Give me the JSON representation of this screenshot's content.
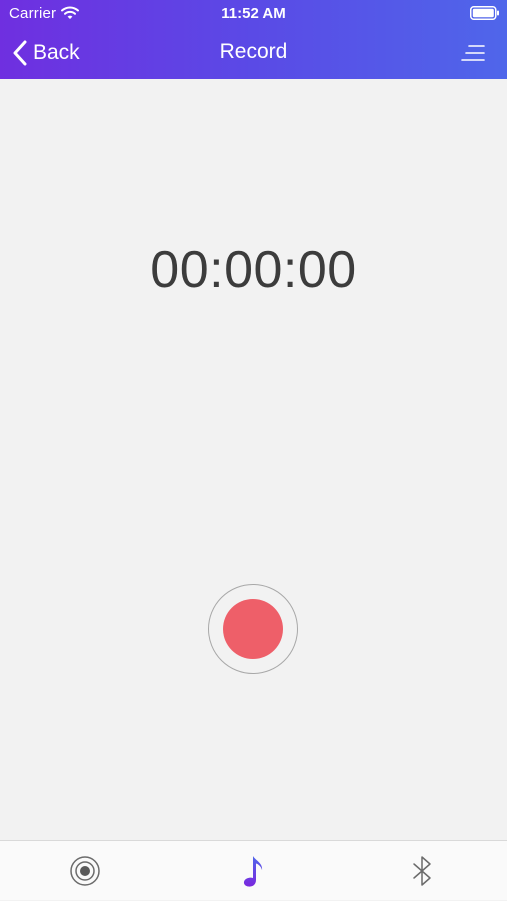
{
  "status_bar": {
    "carrier": "Carrier",
    "time": "11:52 AM"
  },
  "nav": {
    "back_label": "Back",
    "title": "Record",
    "menu_icon": "menu-lines-icon"
  },
  "timer": {
    "value": "00:00:00"
  },
  "record_button": {
    "color": "#ee5f69"
  },
  "tab_bar": {
    "tabs": [
      {
        "icon": "target-icon",
        "selected": false
      },
      {
        "icon": "music-note-icon",
        "selected": true
      },
      {
        "icon": "bluetooth-icon",
        "selected": false
      }
    ]
  },
  "colors": {
    "header_gradient_start": "#6f2fe0",
    "header_gradient_end": "#4f66ea",
    "accent": "#6b35e0",
    "record": "#ee5f69"
  }
}
